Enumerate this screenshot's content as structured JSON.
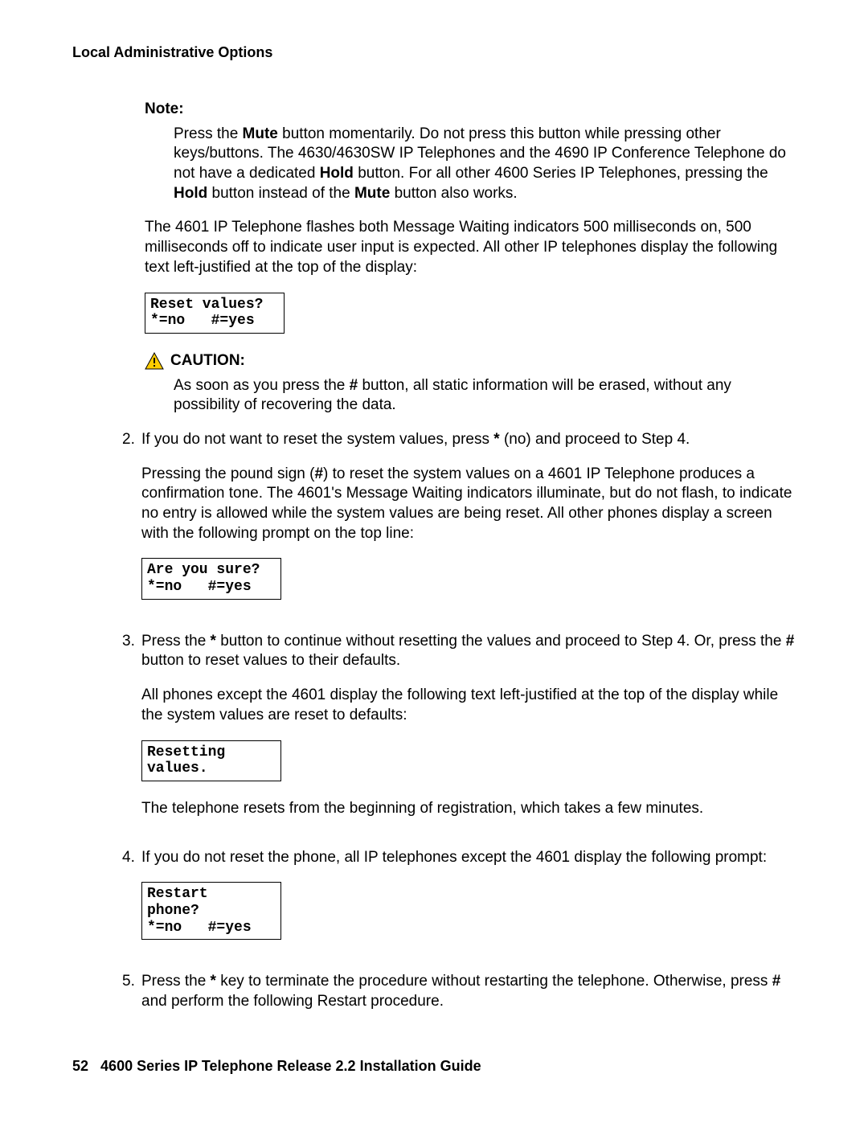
{
  "header": {
    "running_title": "Local Administrative Options"
  },
  "note": {
    "label": "Note:",
    "body_parts": [
      "Press the ",
      "Mute",
      " button momentarily. Do not press this button while pressing other keys/buttons. The 4630/4630SW IP Telephones and the 4690 IP Conference Telephone do not have a dedicated ",
      "Hold",
      " button. For all other 4600 Series IP Telephones, pressing the ",
      "Hold",
      " button instead of the ",
      "Mute",
      " button also works."
    ]
  },
  "para_after_note": "The 4601 IP Telephone flashes both Message Waiting indicators 500 milliseconds on, 500 milliseconds off to indicate user input is expected. All other IP telephones display the following text left-justified at the top of the display:",
  "display1": "Reset values?\n*=no   #=yes",
  "caution": {
    "label": "CAUTION:",
    "body_parts": [
      "As soon as you press the ",
      "#",
      " button, all static information will be erased, without any possibility of recovering the data."
    ]
  },
  "steps": {
    "s2": {
      "num": "2.",
      "p1_parts": [
        "If you do not want to reset the system values, press ",
        "*",
        " (no) and proceed to Step 4."
      ],
      "p2_parts": [
        "Pressing the pound sign (",
        "#",
        ") to reset the system values on a 4601 IP Telephone produces a confirmation tone. The 4601's Message Waiting indicators illuminate, but do not flash, to indicate no entry is allowed while the system values are being reset. All other phones display a screen with the following prompt on the top line:"
      ],
      "display": "Are you sure?\n*=no   #=yes"
    },
    "s3": {
      "num": "3.",
      "p1_parts": [
        "Press the ",
        "*",
        " button to continue without resetting the values and proceed to Step 4. Or, press the ",
        "#",
        " button to reset values to their defaults."
      ],
      "p2": "All phones except the 4601 display the following text left-justified at the top of the display while the system values are reset to defaults:",
      "display": "Resetting\nvalues.",
      "p3": "The telephone resets from the beginning of registration, which takes a few minutes."
    },
    "s4": {
      "num": "4.",
      "p1": "If you do not reset the phone, all IP telephones except the 4601 display the following prompt:",
      "display": "Restart\nphone?\n*=no   #=yes"
    },
    "s5": {
      "num": "5.",
      "p1_parts": [
        "Press the ",
        "*",
        " key to terminate the procedure without restarting the telephone. Otherwise, press ",
        "#",
        " and perform the following Restart procedure."
      ]
    }
  },
  "footer": {
    "page_num": "52",
    "doc_title": "4600 Series IP Telephone Release 2.2 Installation Guide"
  },
  "colors": {
    "caution_fill": "#FFCC00",
    "caution_stroke": "#000000"
  }
}
